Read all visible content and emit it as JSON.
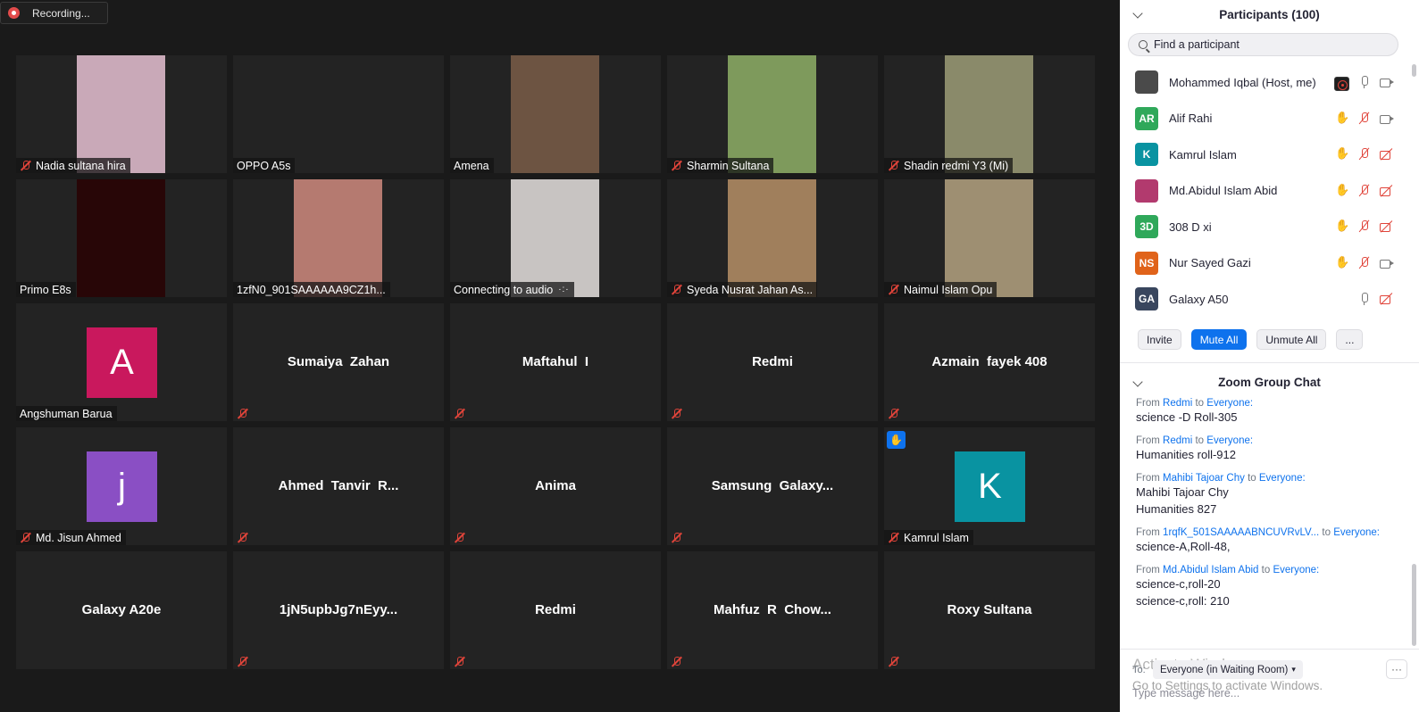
{
  "recording": {
    "label": "Recording..."
  },
  "tiles": [
    {
      "name": "Nadia sultana hira",
      "muted": true,
      "video": true,
      "video_color": "#c9a9b8"
    },
    {
      "name": "OPPO A5s",
      "muted": false,
      "video": false
    },
    {
      "name": "Amena",
      "muted": false,
      "video": true,
      "video_color": "#6d5442"
    },
    {
      "name": "Sharmin Sultana",
      "muted": true,
      "video": true,
      "video_color": "#7e9a5c"
    },
    {
      "name": "Shadin redmi Y3 (Mi)",
      "muted": true,
      "video": true,
      "video_color": "#8a8a6a"
    },
    {
      "name": "Primo E8s",
      "muted": false,
      "video": true,
      "video_color": "#280607"
    },
    {
      "name": "1zfN0_901SAAAAAA9CZ1h...",
      "muted": false,
      "video": true,
      "video_color": "#b57a70"
    },
    {
      "name": "Connecting to audio",
      "muted": false,
      "video": true,
      "video_color": "#c8c4c2",
      "connecting": true
    },
    {
      "name": "Syeda Nusrat Jahan As...",
      "muted": true,
      "video": true,
      "video_color": "#a07f5c"
    },
    {
      "name": "Naimul Islam Opu",
      "muted": true,
      "video": true,
      "video_color": "#9e8f72"
    },
    {
      "name": "Angshuman Barua",
      "muted": false,
      "avatar": "A",
      "avatar_color": "#c9185d"
    },
    {
      "center": "Sumaiya  Zahan",
      "muted": true
    },
    {
      "center": "Maftahul  I",
      "muted": true
    },
    {
      "center": "Redmi",
      "muted": true
    },
    {
      "center": "Azmain  fayek 408",
      "muted": true
    },
    {
      "name": "Md. Jisun Ahmed",
      "muted": true,
      "avatar": "j",
      "avatar_color": "#8a4fc4"
    },
    {
      "center": "Ahmed  Tanvir  R...",
      "muted": true
    },
    {
      "center": "Anima",
      "muted": true
    },
    {
      "center": "Samsung  Galaxy...",
      "muted": true
    },
    {
      "name": "Kamrul Islam",
      "muted": true,
      "avatar": "K",
      "avatar_color": "#0993a1",
      "hand": true
    },
    {
      "center": "Galaxy A20e",
      "muted": false
    },
    {
      "center": "1jN5upbJg7nEyy...",
      "muted": true
    },
    {
      "center": "Redmi",
      "muted": true
    },
    {
      "center": "Mahfuz  R  Chow...",
      "muted": true
    },
    {
      "center": "Roxy Sultana",
      "muted": true
    }
  ],
  "participants": {
    "title": "Participants (100)",
    "search_placeholder": "Find a participant",
    "list": [
      {
        "initials": "",
        "name": "Mohammed Iqbal (Host, me)",
        "color": "#4a4a4a",
        "icons": [
          "rec",
          "mic",
          "cam"
        ]
      },
      {
        "initials": "AR",
        "name": "Alif Rahi",
        "color": "#2fa85a",
        "icons": [
          "hand",
          "micoff",
          "cam"
        ]
      },
      {
        "initials": "K",
        "name": "Kamrul Islam",
        "color": "#0993a1",
        "icons": [
          "hand",
          "micoff",
          "camoff"
        ]
      },
      {
        "initials": "",
        "name": "Md.Abidul Islam Abid",
        "color": "#b23a6e",
        "icons": [
          "hand",
          "micoff",
          "camoff"
        ]
      },
      {
        "initials": "3D",
        "name": "308 D xi",
        "color": "#2fa85a",
        "icons": [
          "hand",
          "micoff",
          "camoff"
        ]
      },
      {
        "initials": "NS",
        "name": "Nur Sayed Gazi",
        "color": "#e0631a",
        "icons": [
          "hand",
          "micoff",
          "cam"
        ]
      },
      {
        "initials": "GA",
        "name": "Galaxy A50",
        "color": "#39465e",
        "icons": [
          "mic",
          "camoff"
        ]
      }
    ],
    "buttons": {
      "invite": "Invite",
      "mute_all": "Mute All",
      "unmute_all": "Unmute All",
      "more": "..."
    }
  },
  "chat": {
    "title": "Zoom Group Chat",
    "messages": [
      {
        "from": "Redmi",
        "to": "Everyone:",
        "lines": [
          "science -D Roll-305"
        ]
      },
      {
        "from": "Redmi",
        "to": "Everyone:",
        "lines": [
          "Humanities roll-912"
        ]
      },
      {
        "from": "Mahibi Tajoar Chy",
        "to": "Everyone:",
        "lines": [
          "Mahibi Tajoar Chy",
          "Humanities 827"
        ]
      },
      {
        "from": "1rqfK_501SAAAAABNCUVRvLV...",
        "to": "Everyone:",
        "lines": [
          "science-A,Roll-48,"
        ]
      },
      {
        "from": "Md.Abidul Islam Abid",
        "to": "Everyone:",
        "lines": [
          "science-c,roll-20",
          "science-c,roll: 210"
        ]
      }
    ],
    "from_word": "From",
    "to_word": "to",
    "to_label": "To:",
    "to_value": "Everyone (in Waiting Room)",
    "more": "···",
    "input_placeholder": "Type message here...",
    "watermark_line1": "Activate Windows",
    "watermark_line2": "Go to Settings to activate Windows."
  }
}
